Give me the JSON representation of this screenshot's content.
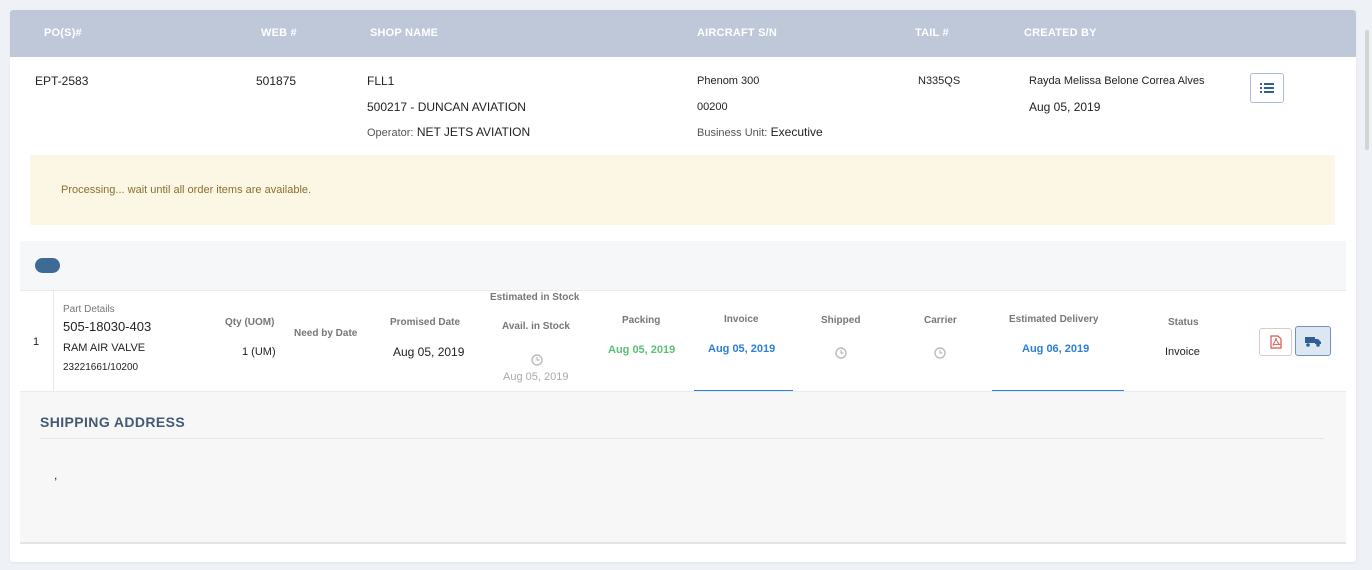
{
  "header": {
    "po_label": "PO(S)#",
    "web_label": "WEB #",
    "shop_label": "SHOP NAME",
    "aircraft_label": "AIRCRAFT S/N",
    "tail_label": "TAIL #",
    "created_label": "CREATED BY"
  },
  "order": {
    "po": "EPT-2583",
    "web": "501875",
    "shop_code": "FLL1",
    "shop_name": "500217 - DUNCAN AVIATION",
    "operator_label": "Operator:",
    "operator": "NET JETS AVIATION",
    "aircraft_model": "Phenom 300",
    "aircraft_sn": "00200",
    "business_unit_label": "Business Unit:",
    "business_unit": "Executive",
    "tail": "N335QS",
    "created_by": "Rayda Melissa Belone Correa Alves",
    "created_date": "Aug 05, 2019"
  },
  "alert": {
    "message": "Processing... wait until all order items are available."
  },
  "item": {
    "index": "1",
    "part_details_label": "Part Details",
    "part_number": "505-18030-403",
    "description": "RAM AIR VALVE",
    "ref": "23221661/10200",
    "qty_label": "Qty (UOM)",
    "qty": "1 (UM)",
    "need_by_label": "Need by Date",
    "promised_label": "Promised Date",
    "promised": "Aug 05, 2019",
    "est_stock_label": "Estimated in Stock",
    "avail_label": "Avail. in Stock",
    "avail": "Aug 05, 2019",
    "packing_label": "Packing",
    "packing": "Aug 05, 2019",
    "invoice_label": "Invoice",
    "invoice": "Aug 05, 2019",
    "shipped_label": "Shipped",
    "carrier_label": "Carrier",
    "est_delivery_label": "Estimated Delivery",
    "est_delivery": "Aug 06, 2019",
    "status_label": "Status",
    "status": "Invoice"
  },
  "shipping": {
    "title": "SHIPPING ADDRESS",
    "address": ","
  },
  "icons": {
    "details": "list-icon",
    "pdf": "pdf-icon",
    "truck": "truck-icon",
    "clock": "clock-icon"
  },
  "colors": {
    "header_bg": "#bfc8d8",
    "alert_bg": "#fcf7e4",
    "accent_blue": "#2b7fd6",
    "packing_green": "#5cbf79",
    "toggle": "#3e6a96"
  }
}
